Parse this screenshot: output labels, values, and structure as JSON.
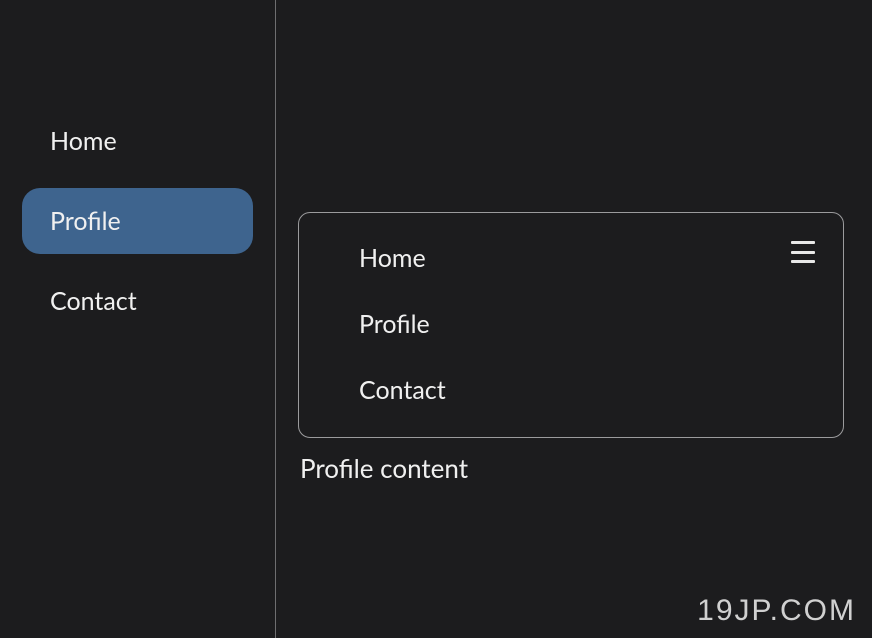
{
  "sidebar": {
    "items": [
      {
        "label": "Home",
        "active": false
      },
      {
        "label": "Profile",
        "active": true
      },
      {
        "label": "Contact",
        "active": false
      }
    ]
  },
  "dropdown": {
    "items": [
      {
        "label": "Home"
      },
      {
        "label": "Profile"
      },
      {
        "label": "Contact"
      }
    ]
  },
  "content": {
    "text": "Profile content"
  },
  "watermark": "19JP.COM"
}
